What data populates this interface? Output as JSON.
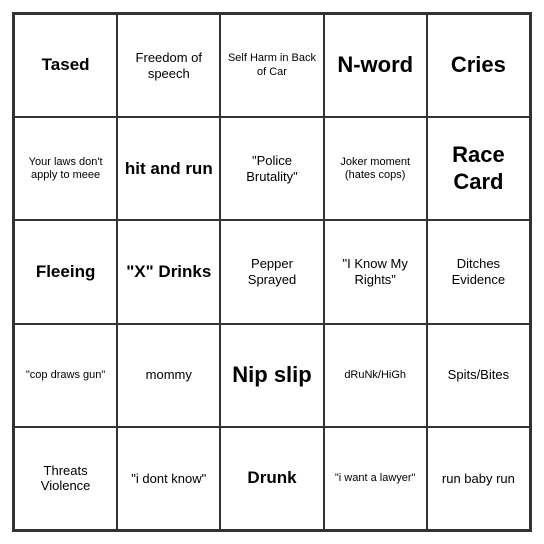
{
  "board": {
    "cells": [
      {
        "text": "Tased",
        "size": "medium"
      },
      {
        "text": "Freedom of speech",
        "size": "normal"
      },
      {
        "text": "Self Harm in Back of Car",
        "size": "small"
      },
      {
        "text": "N-word",
        "size": "large"
      },
      {
        "text": "Cries",
        "size": "large"
      },
      {
        "text": "Your laws don't apply to meee",
        "size": "small"
      },
      {
        "text": "hit and run",
        "size": "medium"
      },
      {
        "text": "\"Police Brutality\"",
        "size": "normal"
      },
      {
        "text": "Joker moment (hates cops)",
        "size": "small"
      },
      {
        "text": "Race Card",
        "size": "large"
      },
      {
        "text": "Fleeing",
        "size": "medium"
      },
      {
        "text": "\"X\" Drinks",
        "size": "medium"
      },
      {
        "text": "Pepper Sprayed",
        "size": "normal"
      },
      {
        "text": "\"I Know My Rights\"",
        "size": "normal"
      },
      {
        "text": "Ditches Evidence",
        "size": "normal"
      },
      {
        "text": "\"cop draws gun\"",
        "size": "small"
      },
      {
        "text": "mommy",
        "size": "normal"
      },
      {
        "text": "Nip slip",
        "size": "large"
      },
      {
        "text": "dRuNk/HiGh",
        "size": "small"
      },
      {
        "text": "Spits/Bites",
        "size": "normal"
      },
      {
        "text": "Threats Violence",
        "size": "normal"
      },
      {
        "text": "\"i dont know\"",
        "size": "normal"
      },
      {
        "text": "Drunk",
        "size": "medium"
      },
      {
        "text": "\"i want a lawyer\"",
        "size": "small"
      },
      {
        "text": "run baby run",
        "size": "normal"
      }
    ]
  }
}
